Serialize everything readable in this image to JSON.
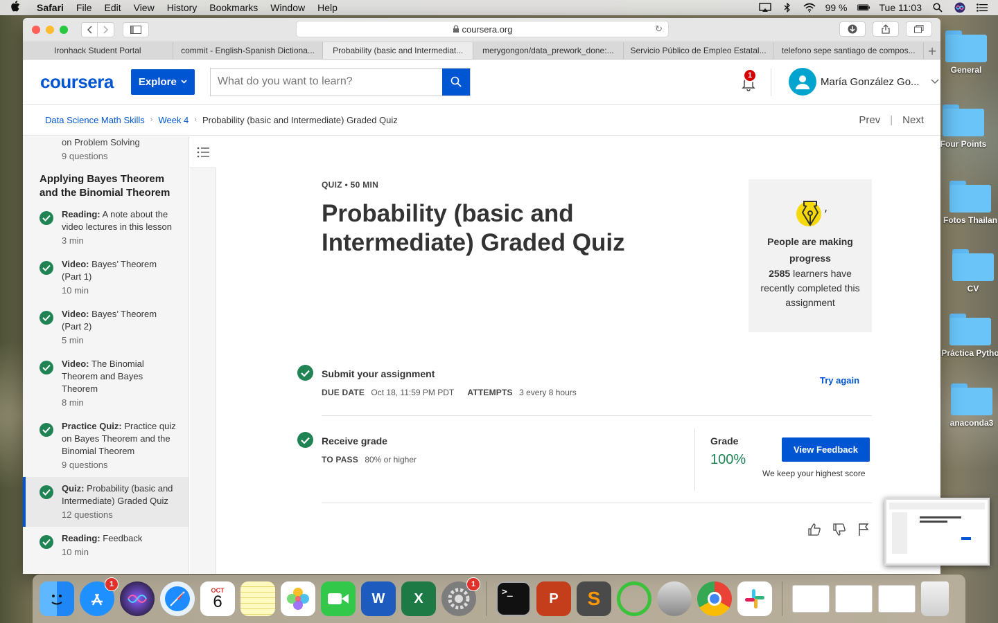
{
  "menubar": {
    "app": "Safari",
    "menus": [
      "File",
      "Edit",
      "View",
      "History",
      "Bookmarks",
      "Window",
      "Help"
    ],
    "battery": "99 %",
    "clock": "Tue 11:03"
  },
  "browser": {
    "url": "coursera.org",
    "tabs": [
      "Ironhack Student Portal",
      "commit - English-Spanish Dictiona...",
      "Probability (basic and Intermediat...",
      "merygongon/data_prework_done:...",
      "Servicio Público de Empleo Estatal...",
      "telefono sepe santiago de compos..."
    ],
    "active_tab": 2
  },
  "header": {
    "logo": "coursera",
    "explore_label": "Explore",
    "search_placeholder": "What do you want to learn?",
    "notifications": "1",
    "user_name": "María González Go..."
  },
  "breadcrumb": {
    "course": "Data Science Math Skills",
    "week": "Week 4",
    "current": "Probability (basic and Intermediate) Graded Quiz",
    "prev": "Prev",
    "next": "Next"
  },
  "sidebar": {
    "top_item": {
      "text": "on Problem Solving",
      "meta": "9 questions"
    },
    "section_title": "Applying Bayes Theorem and the Binomial Theorem",
    "items": [
      {
        "kind": "Reading:",
        "text": "A note about the video lectures in this lesson",
        "meta": "3 min"
      },
      {
        "kind": "Video:",
        "text": "Bayes’ Theorem (Part 1)",
        "meta": "10 min"
      },
      {
        "kind": "Video:",
        "text": "Bayes’ Theorem (Part 2)",
        "meta": "5 min"
      },
      {
        "kind": "Video:",
        "text": "The Binomial Theorem and Bayes Theorem",
        "meta": "8 min"
      },
      {
        "kind": "Practice Quiz:",
        "text": "Practice quiz on Bayes Theorem and the Binomial Theorem",
        "meta": "9 questions"
      },
      {
        "kind": "Quiz:",
        "text": "Probability (basic and Intermediate) Graded Quiz",
        "meta": "12 questions"
      },
      {
        "kind": "Reading:",
        "text": "Feedback",
        "meta": "10 min"
      }
    ]
  },
  "main": {
    "kicker": "QUIZ • 50 MIN",
    "title": "Probability (basic and Intermediate) Graded Quiz",
    "progress_card": {
      "heading": "People are making progress",
      "count": "2585",
      "body": "learners have recently completed this assignment"
    },
    "submit": {
      "title": "Submit your assignment",
      "due_label": "DUE DATE",
      "due_value": "Oct 18, 11:59 PM PDT",
      "attempts_label": "ATTEMPTS",
      "attempts_value": "3 every 8 hours",
      "action": "Try again"
    },
    "grade": {
      "title": "Receive grade",
      "pass_label": "TO PASS",
      "pass_value": "80% or higher",
      "grade_label": "Grade",
      "grade_value": "100%",
      "button": "View Feedback",
      "note": "We keep your highest score"
    }
  },
  "desktop": {
    "folders": [
      "General",
      "Four Points",
      "Fotos Thailan",
      "CV",
      "Práctica Pytho",
      "anaconda3"
    ]
  },
  "dock": {
    "calendar_month": "OCT",
    "calendar_day": "6",
    "badges": {
      "app_store": "1",
      "system_prefs": "1"
    }
  },
  "colors": {
    "accent": "#0056d2",
    "success": "#1f8354",
    "notification": "#d30000"
  }
}
